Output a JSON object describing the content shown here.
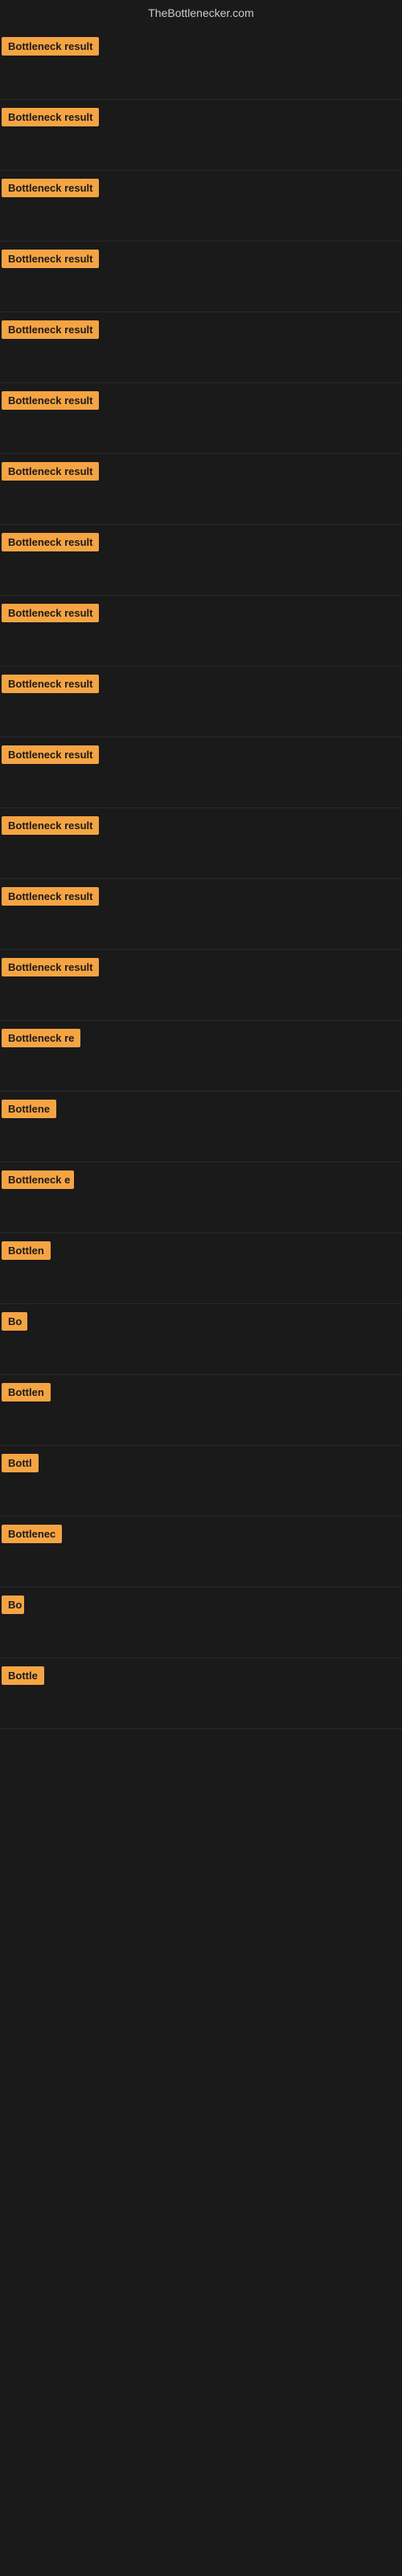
{
  "site_title": "TheBottlenecker.com",
  "rows": [
    {
      "id": 1,
      "label": "Bottleneck result",
      "width": 130
    },
    {
      "id": 2,
      "label": "Bottleneck result",
      "width": 130
    },
    {
      "id": 3,
      "label": "Bottleneck result",
      "width": 130
    },
    {
      "id": 4,
      "label": "Bottleneck result",
      "width": 130
    },
    {
      "id": 5,
      "label": "Bottleneck result",
      "width": 130
    },
    {
      "id": 6,
      "label": "Bottleneck result",
      "width": 130
    },
    {
      "id": 7,
      "label": "Bottleneck result",
      "width": 130
    },
    {
      "id": 8,
      "label": "Bottleneck result",
      "width": 130
    },
    {
      "id": 9,
      "label": "Bottleneck result",
      "width": 130
    },
    {
      "id": 10,
      "label": "Bottleneck result",
      "width": 130
    },
    {
      "id": 11,
      "label": "Bottleneck result",
      "width": 130
    },
    {
      "id": 12,
      "label": "Bottleneck result",
      "width": 130
    },
    {
      "id": 13,
      "label": "Bottleneck result",
      "width": 130
    },
    {
      "id": 14,
      "label": "Bottleneck result",
      "width": 130
    },
    {
      "id": 15,
      "label": "Bottleneck re",
      "width": 100
    },
    {
      "id": 16,
      "label": "Bottlene",
      "width": 75
    },
    {
      "id": 17,
      "label": "Bottleneck e",
      "width": 90
    },
    {
      "id": 18,
      "label": "Bottlen",
      "width": 68
    },
    {
      "id": 19,
      "label": "Bo",
      "width": 32
    },
    {
      "id": 20,
      "label": "Bottlen",
      "width": 68
    },
    {
      "id": 21,
      "label": "Bottl",
      "width": 50
    },
    {
      "id": 22,
      "label": "Bottlenec",
      "width": 82
    },
    {
      "id": 23,
      "label": "Bo",
      "width": 28
    },
    {
      "id": 24,
      "label": "Bottle",
      "width": 56
    }
  ]
}
